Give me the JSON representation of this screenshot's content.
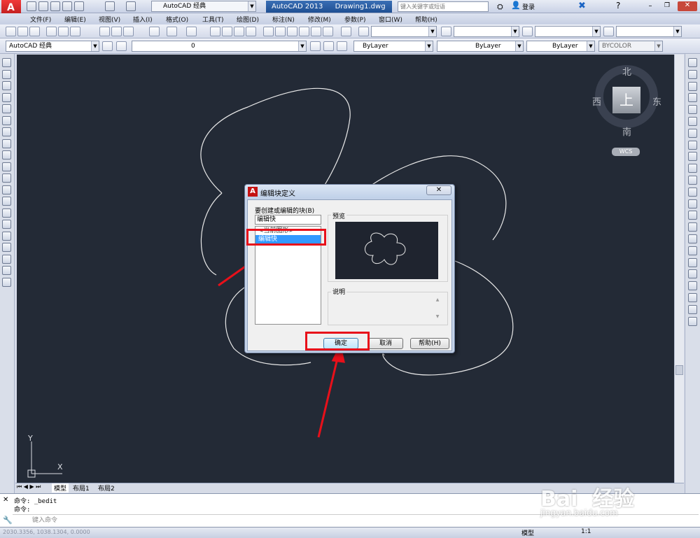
{
  "app": {
    "workspace": "AutoCAD 经典",
    "title": "AutoCAD 2013",
    "filename": "Drawing1.dwg",
    "search_placeholder": "键入关键字或短语",
    "login": "登录"
  },
  "menu": [
    "文件(F)",
    "编辑(E)",
    "视图(V)",
    "插入(I)",
    "格式(O)",
    "工具(T)",
    "绘图(D)",
    "标注(N)",
    "修改(M)",
    "参数(P)",
    "窗口(W)",
    "帮助(H)"
  ],
  "toolbar2": {
    "workspace": "AutoCAD 经典",
    "layer": "0",
    "color": "ByLayer",
    "linetype": "ByLayer",
    "lineweight": "ByLayer",
    "plotstyle": "BYCOLOR"
  },
  "viewcube": {
    "north": "北",
    "south": "南",
    "east": "东",
    "west": "西",
    "face": "上",
    "wcs": "WCS"
  },
  "ucs": {
    "y": "Y",
    "x": "X"
  },
  "tabs": [
    "模型",
    "布局1",
    "布局2"
  ],
  "command": {
    "line1": "命令:  _bedit",
    "line2": "命令:",
    "placeholder": "键入命令"
  },
  "status": {
    "coords": "2030.3356, 1038.1304, 0.0000",
    "model": "模型",
    "scale": "1:1"
  },
  "dialog": {
    "title": "编辑块定义",
    "prompt_label": "要创建或编辑的块(B)",
    "block_name_value": "编辑快",
    "list_items": [
      "<当前图形>",
      "编辑快"
    ],
    "selected_item": "编辑快",
    "preview_label": "预览",
    "description_label": "说明",
    "ok_label": "确定",
    "cancel_label": "取消",
    "help_label": "帮助(H)"
  },
  "watermark": {
    "brand": "Bai  经验",
    "url": "jingyan.baidu.com"
  }
}
